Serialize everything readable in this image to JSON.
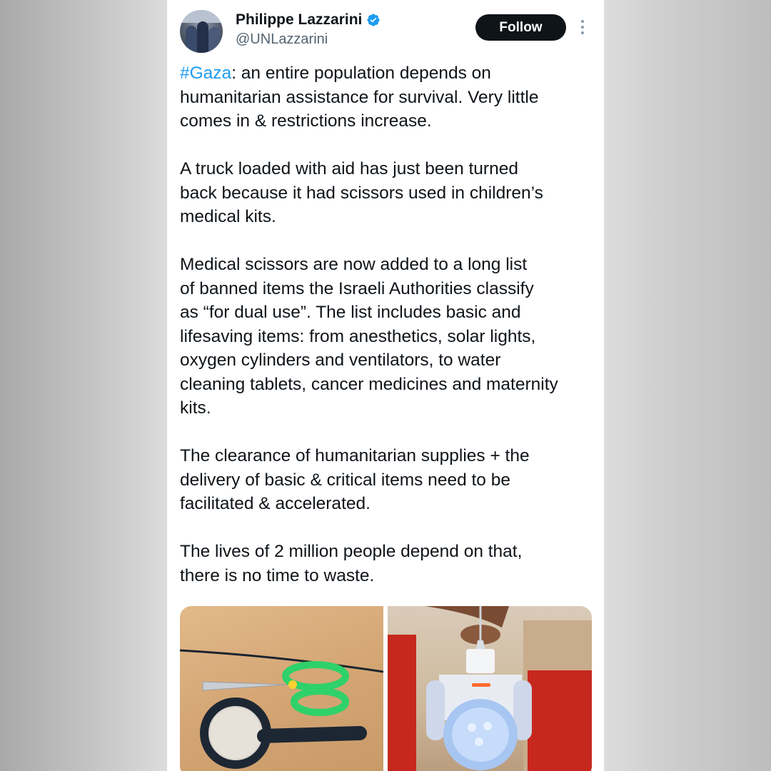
{
  "author": {
    "name": "Philippe Lazzarini",
    "handle": "@UNLazzarini",
    "verified_color": "#1d9bf0"
  },
  "actions": {
    "follow_label": "Follow",
    "more_icon": "more-vertical-icon"
  },
  "tweet": {
    "hashtag": "#Gaza",
    "p1_rest": ": an entire population depends on\nhumanitarian assistance for survival. Very little\ncomes in & restrictions increase.",
    "p2": "A truck loaded with aid has just been turned\nback because it had scissors used in children’s\nmedical kits.",
    "p3": "Medical scissors are now added to a long list\nof banned items the Israeli Authorities classify\nas “for dual use”. The list includes basic and\nlifesaving items: from anesthetics, solar lights,\noxygen cylinders and ventilators, to water\ncleaning tablets, cancer medicines and maternity\nkits.",
    "p4": "The clearance of humanitarian supplies + the\ndelivery of basic & critical items need to be\nfacilitated & accelerated.",
    "p5": "The lives of 2 million people depend on that,\nthere is no time to waste."
  },
  "media": {
    "photo_left": "scissors-and-magnifier-photo",
    "photo_right": "solar-lamp-photo"
  },
  "colors": {
    "text": "#0f1419",
    "secondary": "#536471",
    "link": "#1d9bf0",
    "button": "#0f1419"
  }
}
